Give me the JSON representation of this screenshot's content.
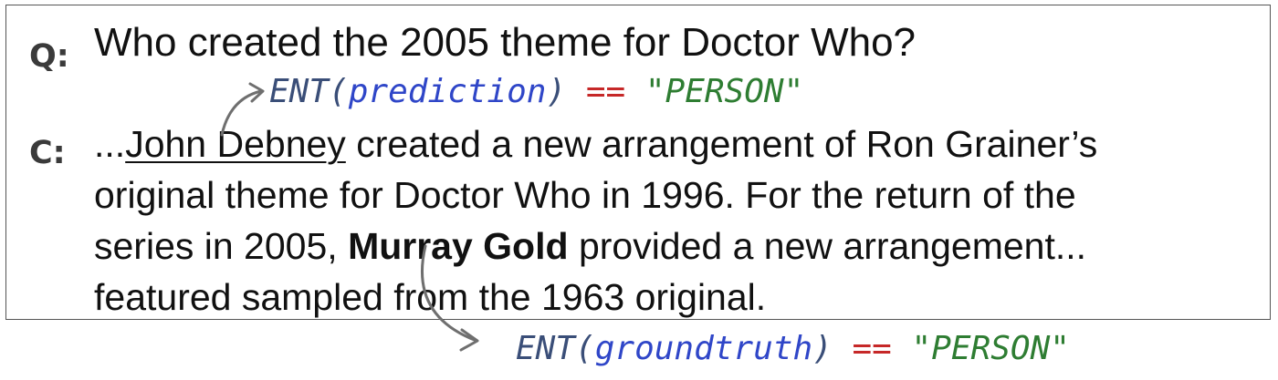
{
  "labels": {
    "question": "Q:",
    "context": "C:"
  },
  "question": "Who created the 2005 theme for Doctor Who?",
  "context": {
    "line1": {
      "prefix": "...",
      "underlined": "John Debney",
      "rest": " created a new arrangement of Ron Grainer’s"
    },
    "line2": "original theme for Doctor Who in 1996. For the return of the",
    "line3": {
      "prefix": "series in 2005, ",
      "bold": "Murray Gold",
      "rest": " provided a new arrangement..."
    },
    "line4": "featured sampled from the 1963 original."
  },
  "prediction_check": {
    "fn": "ENT",
    "open": "(",
    "arg": "prediction",
    "close": ")",
    "op": " == ",
    "value": "\"PERSON\""
  },
  "groundtruth_check": {
    "fn": "ENT",
    "open": "(",
    "arg": "groundtruth",
    "close": ")",
    "op": " == ",
    "value": "\"PERSON\""
  },
  "colors": {
    "function": "#3a4e78",
    "argument": "#2f46c8",
    "operator": "#c62828",
    "string": "#2e7d32",
    "arrow": "#6f6f6f",
    "border": "#555555"
  }
}
